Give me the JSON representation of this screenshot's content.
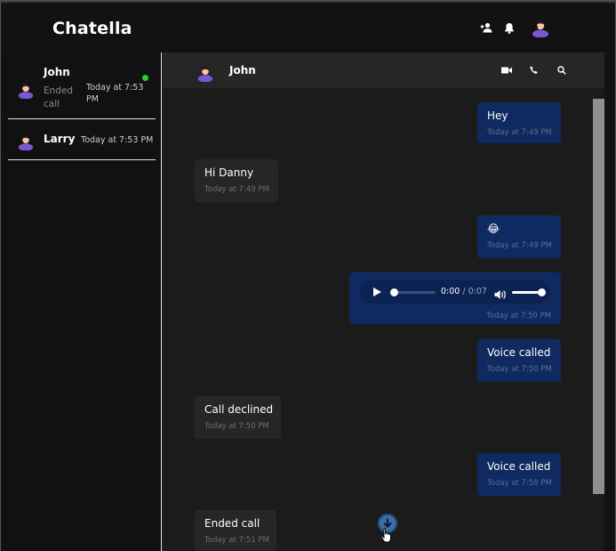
{
  "app": {
    "brand": "Chatella"
  },
  "header": {
    "icons": [
      "add-user-icon",
      "bell-icon",
      "avatar"
    ]
  },
  "sidebar": {
    "contacts": [
      {
        "name": "John",
        "subtitle": "Ended call",
        "time": "Today at 7:53 PM",
        "online": true
      },
      {
        "name": "Larry",
        "subtitle": "",
        "time": "Today at 7:53 PM",
        "online": false
      }
    ]
  },
  "chat": {
    "contact_name": "John",
    "icons": [
      "video-call-icon",
      "phone-icon",
      "search-icon"
    ],
    "messages": [
      {
        "direction": "out",
        "text": "Hey",
        "time": "Today at 7:49 PM"
      },
      {
        "direction": "in",
        "text": "Hi Danny",
        "time": "Today at 7:49 PM"
      },
      {
        "direction": "out",
        "text": "😂",
        "time": "Today at 7:49 PM"
      },
      {
        "direction": "out",
        "type": "audio",
        "current": "0:00",
        "duration": "0:07",
        "time": "Today at 7:50 PM"
      },
      {
        "direction": "out",
        "text": "Voice called",
        "time": "Today at 7:50 PM"
      },
      {
        "direction": "in",
        "text": "Call declined",
        "time": "Today at 7:50 PM"
      },
      {
        "direction": "out",
        "text": "Voice called",
        "time": "Today at 7:50 PM"
      },
      {
        "direction": "in",
        "text": "Ended call",
        "time": "Today at 7:51 PM"
      }
    ],
    "audio_time_separator": " / "
  },
  "colors": {
    "outgoing_bubble": "#0e2a60",
    "incoming_bubble": "#262626",
    "online": "#23d13a",
    "scroll_button": "#3a6fa8"
  }
}
